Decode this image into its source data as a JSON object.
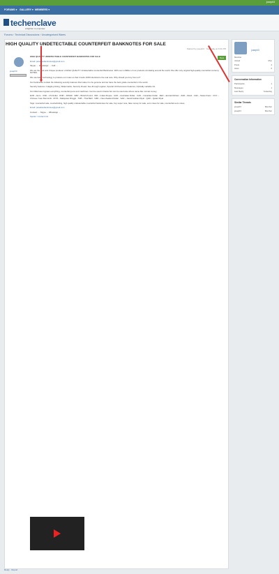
{
  "topbar": {
    "right": "joseph3"
  },
  "nav": {
    "items": [
      "FORUMS ▾",
      "GALLERY ▾",
      "MEMBERS ▾"
    ]
  },
  "logo": {
    "main": "techenclave",
    "sub": "enlighten to empower"
  },
  "breadcrumb": "Forums › Technical Discussions › Uncategorised Wares",
  "thread": {
    "title": "HIGH QUALITY UNDETECTABLE COUNTERFEIT BANKNOTES FOR SALE",
    "meta": "Started by joseph3 · Yesterday at 6:41 PM",
    "badge": "New"
  },
  "post": {
    "user": "joseph3",
    "paragraphs": [
      "HIGH QUALITY UNDETECTABLE COUNTERFEIT BANKNOTES FOR SALE",
      "Email: paradisebanknotes@gmail.com",
      "Skype: ... WhatsApp: ... Call: ...",
      "We are the best and Unique producer of HIGH QUALITY Undetectable counterfeit Banknotes. With over a Million of our products circulating around the world. We offer only original high-quality counterfeit currency NOTES.",
      "We use latest technology to produce our notes so that it looks 100% identical to the real note. Why should you buy from us?",
      "Our banknotes contain the following security features that make it to be genuine and we have the best grade counterfeit in the world.",
      "Security features: Intaglio printing, Watermarks, Security thread, See-through register, Special UV-fluorescent features, Optically variable ink.",
      "Our bills/notes bypass everything, counterfeit pens and machines. Can be used in banks but can be used else where same like normal money.",
      "EUR – Euro · USD – US Dollar · DNR – DINAR · GBP – British Pound · INR – Indian Rupee · AUD – Australian Dollar · CAD – Canadian Dollar · AED – Emirati Dirham · ZAR – Rand · CHF – Swiss Franc · CNY – Chinese Yuan Renminbi · MYR – Malaysian Ringgit · THB – Thai Baht · NZD – New Zealand Dollar · SAR – Saudi Arabian Riyal · QAR – Qatari Riyal",
      "Tags: counterfeit sale, counterfeiting, high quality undetectable counterfeit banknotes for sale, buy super note, fake money for sale, euro notes for sale, counterfeit euro notes.",
      "Email: paradisebanknotes@gmail.com",
      "Contact: ... Skype ... WhatsApp ...",
      "Spoiler: Contact Info"
    ]
  },
  "sidebar": {
    "user": "joseph3",
    "role": "Member",
    "stats": [
      [
        "Joined",
        "Mon"
      ],
      [
        "Posts",
        "2"
      ],
      [
        "Likes",
        "0"
      ]
    ],
    "section_title": "Conversation Information",
    "kv": [
      [
        "Participants",
        "1"
      ],
      [
        "Messages",
        "1"
      ],
      [
        "Last Reply",
        "Yesterday"
      ]
    ],
    "members_title": "Similar Threads",
    "members": [
      [
        "joseph3",
        "Member"
      ],
      [
        "joseph3",
        "Member"
      ]
    ]
  },
  "footer": "Reply · Report"
}
